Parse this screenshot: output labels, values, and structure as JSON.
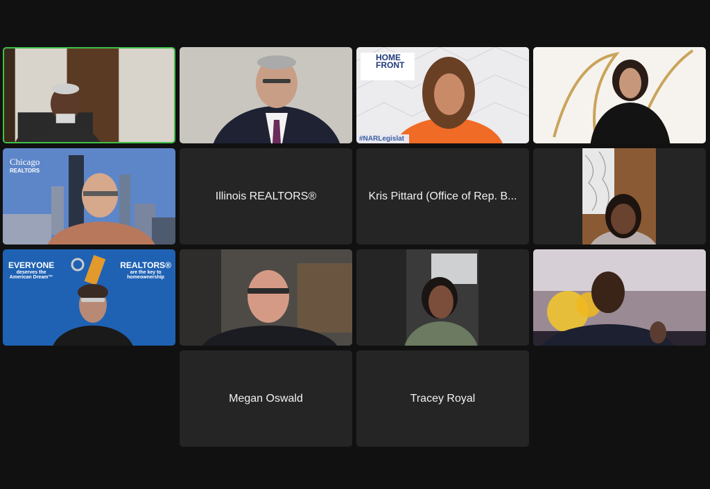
{
  "participants": [
    {
      "name": "",
      "video": true,
      "speaking": true,
      "icon": "camera-feed"
    },
    {
      "name": "",
      "video": true,
      "speaking": false,
      "icon": "camera-feed"
    },
    {
      "name": "",
      "video": true,
      "speaking": false,
      "icon": "camera-feed",
      "overlay": {
        "brand_line1": "HOME",
        "brand_line2": "FRONT",
        "hashtag": "#NARLegislat"
      }
    },
    {
      "name": "",
      "video": true,
      "speaking": false,
      "icon": "camera-feed"
    },
    {
      "name": "",
      "video": true,
      "speaking": false,
      "icon": "camera-feed",
      "overlay": {
        "brand": "Chicago",
        "brand_sub": "REALTORS"
      }
    },
    {
      "name": "Illinois REALTORS®",
      "video": false,
      "speaking": false
    },
    {
      "name": "Kris Pittard (Office of Rep. B...",
      "video": false,
      "speaking": false
    },
    {
      "name": "",
      "video": true,
      "speaking": false,
      "icon": "camera-feed"
    },
    {
      "name": "",
      "video": true,
      "speaking": false,
      "icon": "camera-feed",
      "overlay": {
        "left_title": "EVERYONE",
        "left_sub1": "deserves the",
        "left_sub2": "American Dream™",
        "right_title": "REALTORS®",
        "right_sub1": "are the key to",
        "right_sub2": "homeownership"
      }
    },
    {
      "name": "",
      "video": true,
      "speaking": false,
      "icon": "camera-feed"
    },
    {
      "name": "",
      "video": true,
      "speaking": false,
      "icon": "camera-feed"
    },
    {
      "name": "",
      "video": true,
      "speaking": false,
      "icon": "camera-feed"
    },
    {
      "name": "Megan Oswald",
      "video": false,
      "speaking": false
    },
    {
      "name": "Tracey Royal",
      "video": false,
      "speaking": false
    }
  ],
  "colors": {
    "background": "#111111",
    "tile": "#252525",
    "active_speaker_border": "#3ec24a",
    "name_text": "#f2f2f2"
  }
}
